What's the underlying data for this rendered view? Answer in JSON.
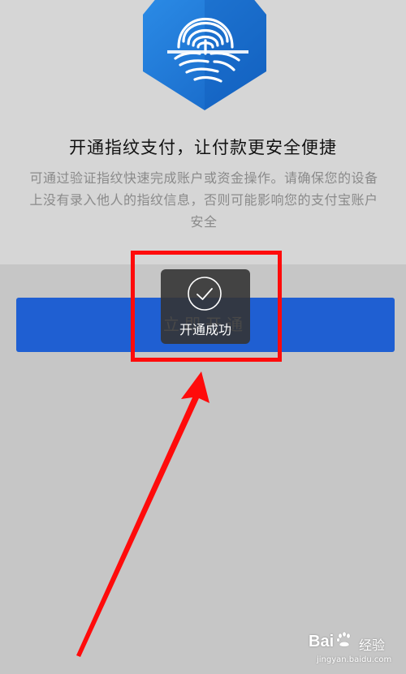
{
  "fingerprint_screen": {
    "headline": "开通指纹支付，让付款更安全便捷",
    "description": "可通过验证指纹快速完成账户或资金操作。请确保您的设备上没有录入他人的指纹信息，否则可能影响您的支付宝账户安全",
    "enable_button_label": "立即开通",
    "badge_color": "#1a73d6",
    "button_color": "#1f5fd2"
  },
  "toast": {
    "icon": "checkmark-circle-icon",
    "label": "开通成功"
  },
  "annotation": {
    "highlight_color": "#ff0b0b",
    "arrow_color": "#ff0b0b"
  },
  "watermark": {
    "brand": "Bai",
    "paw_icon": "paw-icon",
    "brand_suffix": "经验",
    "domain": "jingyan.baidu.com"
  }
}
